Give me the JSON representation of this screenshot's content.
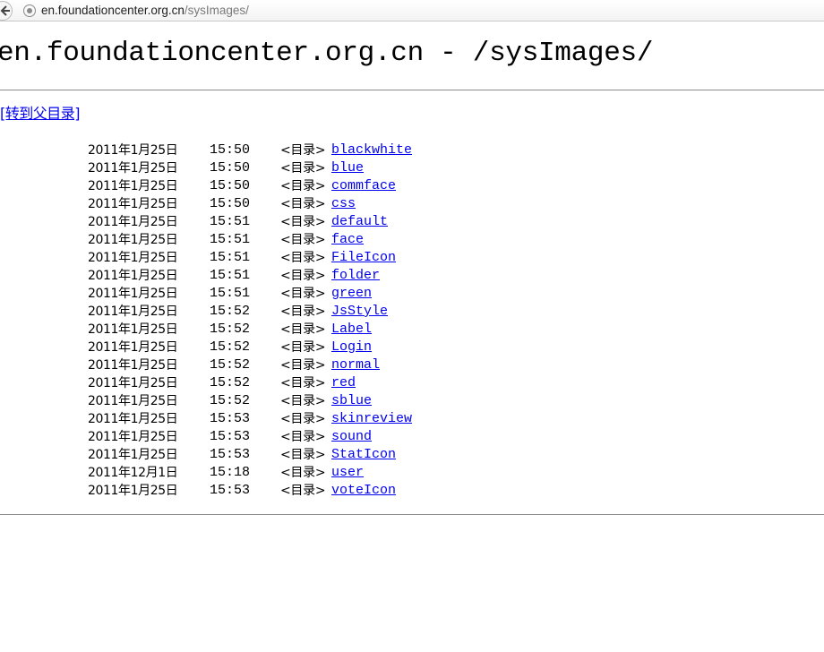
{
  "browser": {
    "url_host": "en.foundationcenter.org.cn",
    "url_path": "/sysImages/"
  },
  "page": {
    "title": "en.foundationcenter.org.cn - /sysImages/",
    "parent_link": "[转到父目录]",
    "dir_label": "<目录>",
    "entries": [
      {
        "date": "2011年1月25日",
        "time": "15:50",
        "name": "blackwhite"
      },
      {
        "date": "2011年1月25日",
        "time": "15:50",
        "name": "blue"
      },
      {
        "date": "2011年1月25日",
        "time": "15:50",
        "name": "commface"
      },
      {
        "date": "2011年1月25日",
        "time": "15:50",
        "name": "css"
      },
      {
        "date": "2011年1月25日",
        "time": "15:51",
        "name": "default"
      },
      {
        "date": "2011年1月25日",
        "time": "15:51",
        "name": "face"
      },
      {
        "date": "2011年1月25日",
        "time": "15:51",
        "name": "FileIcon"
      },
      {
        "date": "2011年1月25日",
        "time": "15:51",
        "name": "folder"
      },
      {
        "date": "2011年1月25日",
        "time": "15:51",
        "name": "green"
      },
      {
        "date": "2011年1月25日",
        "time": "15:52",
        "name": "JsStyle"
      },
      {
        "date": "2011年1月25日",
        "time": "15:52",
        "name": "Label"
      },
      {
        "date": "2011年1月25日",
        "time": "15:52",
        "name": "Login"
      },
      {
        "date": "2011年1月25日",
        "time": "15:52",
        "name": "normal"
      },
      {
        "date": "2011年1月25日",
        "time": "15:52",
        "name": "red"
      },
      {
        "date": "2011年1月25日",
        "time": "15:52",
        "name": "sblue"
      },
      {
        "date": "2011年1月25日",
        "time": "15:53",
        "name": "skinreview"
      },
      {
        "date": "2011年1月25日",
        "time": "15:53",
        "name": "sound"
      },
      {
        "date": "2011年1月25日",
        "time": "15:53",
        "name": "StatIcon"
      },
      {
        "date": "2011年12月1日",
        "time": "15:18",
        "name": "user"
      },
      {
        "date": "2011年1月25日",
        "time": "15:53",
        "name": "voteIcon"
      }
    ]
  }
}
